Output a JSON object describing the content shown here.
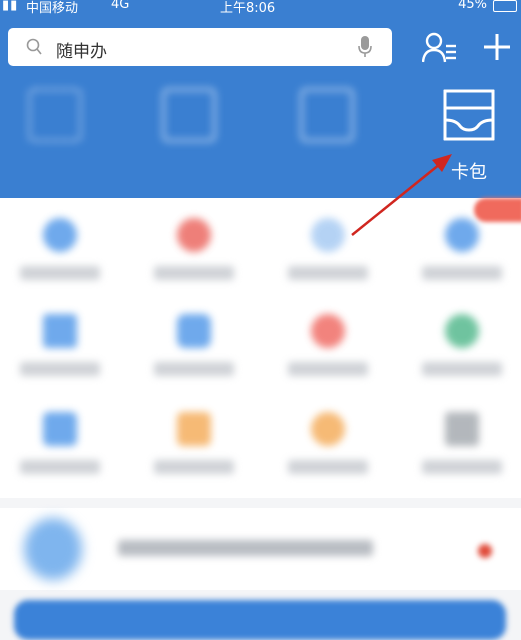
{
  "status_bar": {
    "signal_icon": "signal-bars-icon",
    "carrier": "中国移动",
    "network": "4G",
    "time": "上午8:06",
    "battery": "45%"
  },
  "search": {
    "placeholder": "随申办",
    "icon": "search-icon",
    "mic_icon": "microphone-icon"
  },
  "header_actions": {
    "person_icon": "person-list-icon",
    "plus_icon": "plus-icon"
  },
  "quick_actions": [
    {
      "label": "",
      "icon": "scan-icon"
    },
    {
      "label": "",
      "icon": "card-icon"
    },
    {
      "label": "",
      "icon": "play-icon"
    },
    {
      "label": "卡包",
      "icon": "card-wallet-icon"
    }
  ],
  "services_colors": [
    "#3f8de6",
    "#e9554d",
    "#7fb1ee",
    "#3f8de6",
    "#3f8de6",
    "#3f8de6",
    "#ee5a52",
    "#3fb07f",
    "#3f8de6",
    "#f3a348",
    "#f3a348",
    "#9aa0a6"
  ],
  "annotation": {
    "color": "#d0261f"
  },
  "colors": {
    "header_blue": "#3a7fd1",
    "white": "#ffffff"
  }
}
